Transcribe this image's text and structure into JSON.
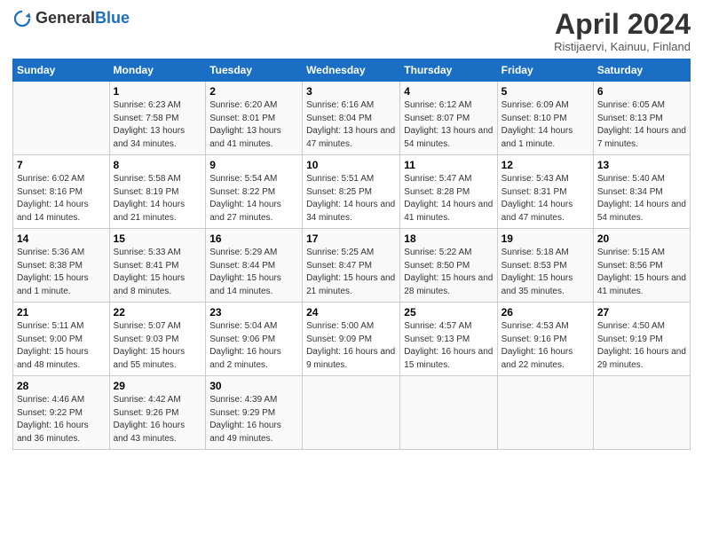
{
  "header": {
    "logo_general": "General",
    "logo_blue": "Blue",
    "title": "April 2024",
    "subtitle": "Ristijaervi, Kainuu, Finland"
  },
  "days_of_week": [
    "Sunday",
    "Monday",
    "Tuesday",
    "Wednesday",
    "Thursday",
    "Friday",
    "Saturday"
  ],
  "weeks": [
    [
      {
        "day": "",
        "sunrise": "",
        "sunset": "",
        "daylight": ""
      },
      {
        "day": "1",
        "sunrise": "Sunrise: 6:23 AM",
        "sunset": "Sunset: 7:58 PM",
        "daylight": "Daylight: 13 hours and 34 minutes."
      },
      {
        "day": "2",
        "sunrise": "Sunrise: 6:20 AM",
        "sunset": "Sunset: 8:01 PM",
        "daylight": "Daylight: 13 hours and 41 minutes."
      },
      {
        "day": "3",
        "sunrise": "Sunrise: 6:16 AM",
        "sunset": "Sunset: 8:04 PM",
        "daylight": "Daylight: 13 hours and 47 minutes."
      },
      {
        "day": "4",
        "sunrise": "Sunrise: 6:12 AM",
        "sunset": "Sunset: 8:07 PM",
        "daylight": "Daylight: 13 hours and 54 minutes."
      },
      {
        "day": "5",
        "sunrise": "Sunrise: 6:09 AM",
        "sunset": "Sunset: 8:10 PM",
        "daylight": "Daylight: 14 hours and 1 minute."
      },
      {
        "day": "6",
        "sunrise": "Sunrise: 6:05 AM",
        "sunset": "Sunset: 8:13 PM",
        "daylight": "Daylight: 14 hours and 7 minutes."
      }
    ],
    [
      {
        "day": "7",
        "sunrise": "Sunrise: 6:02 AM",
        "sunset": "Sunset: 8:16 PM",
        "daylight": "Daylight: 14 hours and 14 minutes."
      },
      {
        "day": "8",
        "sunrise": "Sunrise: 5:58 AM",
        "sunset": "Sunset: 8:19 PM",
        "daylight": "Daylight: 14 hours and 21 minutes."
      },
      {
        "day": "9",
        "sunrise": "Sunrise: 5:54 AM",
        "sunset": "Sunset: 8:22 PM",
        "daylight": "Daylight: 14 hours and 27 minutes."
      },
      {
        "day": "10",
        "sunrise": "Sunrise: 5:51 AM",
        "sunset": "Sunset: 8:25 PM",
        "daylight": "Daylight: 14 hours and 34 minutes."
      },
      {
        "day": "11",
        "sunrise": "Sunrise: 5:47 AM",
        "sunset": "Sunset: 8:28 PM",
        "daylight": "Daylight: 14 hours and 41 minutes."
      },
      {
        "day": "12",
        "sunrise": "Sunrise: 5:43 AM",
        "sunset": "Sunset: 8:31 PM",
        "daylight": "Daylight: 14 hours and 47 minutes."
      },
      {
        "day": "13",
        "sunrise": "Sunrise: 5:40 AM",
        "sunset": "Sunset: 8:34 PM",
        "daylight": "Daylight: 14 hours and 54 minutes."
      }
    ],
    [
      {
        "day": "14",
        "sunrise": "Sunrise: 5:36 AM",
        "sunset": "Sunset: 8:38 PM",
        "daylight": "Daylight: 15 hours and 1 minute."
      },
      {
        "day": "15",
        "sunrise": "Sunrise: 5:33 AM",
        "sunset": "Sunset: 8:41 PM",
        "daylight": "Daylight: 15 hours and 8 minutes."
      },
      {
        "day": "16",
        "sunrise": "Sunrise: 5:29 AM",
        "sunset": "Sunset: 8:44 PM",
        "daylight": "Daylight: 15 hours and 14 minutes."
      },
      {
        "day": "17",
        "sunrise": "Sunrise: 5:25 AM",
        "sunset": "Sunset: 8:47 PM",
        "daylight": "Daylight: 15 hours and 21 minutes."
      },
      {
        "day": "18",
        "sunrise": "Sunrise: 5:22 AM",
        "sunset": "Sunset: 8:50 PM",
        "daylight": "Daylight: 15 hours and 28 minutes."
      },
      {
        "day": "19",
        "sunrise": "Sunrise: 5:18 AM",
        "sunset": "Sunset: 8:53 PM",
        "daylight": "Daylight: 15 hours and 35 minutes."
      },
      {
        "day": "20",
        "sunrise": "Sunrise: 5:15 AM",
        "sunset": "Sunset: 8:56 PM",
        "daylight": "Daylight: 15 hours and 41 minutes."
      }
    ],
    [
      {
        "day": "21",
        "sunrise": "Sunrise: 5:11 AM",
        "sunset": "Sunset: 9:00 PM",
        "daylight": "Daylight: 15 hours and 48 minutes."
      },
      {
        "day": "22",
        "sunrise": "Sunrise: 5:07 AM",
        "sunset": "Sunset: 9:03 PM",
        "daylight": "Daylight: 15 hours and 55 minutes."
      },
      {
        "day": "23",
        "sunrise": "Sunrise: 5:04 AM",
        "sunset": "Sunset: 9:06 PM",
        "daylight": "Daylight: 16 hours and 2 minutes."
      },
      {
        "day": "24",
        "sunrise": "Sunrise: 5:00 AM",
        "sunset": "Sunset: 9:09 PM",
        "daylight": "Daylight: 16 hours and 9 minutes."
      },
      {
        "day": "25",
        "sunrise": "Sunrise: 4:57 AM",
        "sunset": "Sunset: 9:13 PM",
        "daylight": "Daylight: 16 hours and 15 minutes."
      },
      {
        "day": "26",
        "sunrise": "Sunrise: 4:53 AM",
        "sunset": "Sunset: 9:16 PM",
        "daylight": "Daylight: 16 hours and 22 minutes."
      },
      {
        "day": "27",
        "sunrise": "Sunrise: 4:50 AM",
        "sunset": "Sunset: 9:19 PM",
        "daylight": "Daylight: 16 hours and 29 minutes."
      }
    ],
    [
      {
        "day": "28",
        "sunrise": "Sunrise: 4:46 AM",
        "sunset": "Sunset: 9:22 PM",
        "daylight": "Daylight: 16 hours and 36 minutes."
      },
      {
        "day": "29",
        "sunrise": "Sunrise: 4:42 AM",
        "sunset": "Sunset: 9:26 PM",
        "daylight": "Daylight: 16 hours and 43 minutes."
      },
      {
        "day": "30",
        "sunrise": "Sunrise: 4:39 AM",
        "sunset": "Sunset: 9:29 PM",
        "daylight": "Daylight: 16 hours and 49 minutes."
      },
      {
        "day": "",
        "sunrise": "",
        "sunset": "",
        "daylight": ""
      },
      {
        "day": "",
        "sunrise": "",
        "sunset": "",
        "daylight": ""
      },
      {
        "day": "",
        "sunrise": "",
        "sunset": "",
        "daylight": ""
      },
      {
        "day": "",
        "sunrise": "",
        "sunset": "",
        "daylight": ""
      }
    ]
  ]
}
